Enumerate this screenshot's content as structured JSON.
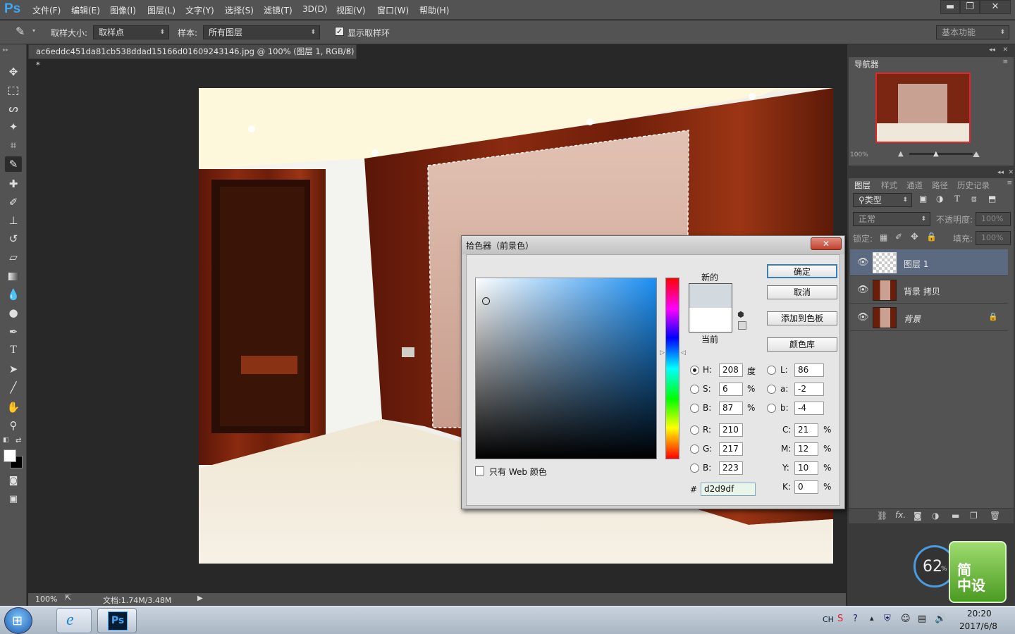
{
  "app": {
    "logo": "Ps"
  },
  "menu": [
    "文件(F)",
    "编辑(E)",
    "图像(I)",
    "图层(L)",
    "文字(Y)",
    "选择(S)",
    "滤镜(T)",
    "3D(D)",
    "视图(V)",
    "窗口(W)",
    "帮助(H)"
  ],
  "window_controls": {
    "minimize": "▬",
    "restore": "❐",
    "close": "✕"
  },
  "options": {
    "sample_size_label": "取样大小:",
    "sample_size_value": "取样点",
    "sample_label": "样本:",
    "sample_value": "所有图层",
    "show_ring_label": "显示取样环",
    "workspace": "基本功能"
  },
  "document": {
    "tab_title": "ac6eddc451da81cb538ddad15166d01609243146.jpg @ 100% (图层 1, RGB/8) *",
    "close": "✕"
  },
  "status": {
    "zoom": "100%",
    "doc_info": "文档:1.74M/3.48M"
  },
  "navigator": {
    "tab": "导航器",
    "zoom": "100%"
  },
  "layers_panel": {
    "tabs": [
      "图层",
      "样式",
      "通道",
      "路径",
      "历史记录"
    ],
    "filter_label": "类型",
    "blend_mode": "正常",
    "opacity_label": "不透明度:",
    "opacity_value": "100%",
    "lock_label": "锁定:",
    "fill_label": "填充:",
    "fill_value": "100%",
    "layers": [
      {
        "name": "图层 1",
        "selected": true
      },
      {
        "name": "背景 拷贝",
        "selected": false
      },
      {
        "name": "背景",
        "selected": false,
        "locked": true
      }
    ]
  },
  "color_picker": {
    "title": "拾色器（前景色）",
    "new_label": "新的",
    "current_label": "当前",
    "new_color": "#d2d9df",
    "current_color": "#ffffff",
    "buttons": {
      "ok": "确定",
      "cancel": "取消",
      "add_swatch": "添加到色板",
      "libraries": "颜色库"
    },
    "web_only_label": "只有 Web 颜色",
    "fields": {
      "H": {
        "label": "H:",
        "value": "208",
        "unit": "度"
      },
      "S": {
        "label": "S:",
        "value": "6",
        "unit": "%"
      },
      "Bv": {
        "label": "B:",
        "value": "87",
        "unit": "%"
      },
      "R": {
        "label": "R:",
        "value": "210"
      },
      "G": {
        "label": "G:",
        "value": "217"
      },
      "Bc": {
        "label": "B:",
        "value": "223"
      },
      "L": {
        "label": "L:",
        "value": "86"
      },
      "a": {
        "label": "a:",
        "value": "-2"
      },
      "b": {
        "label": "b:",
        "value": "-4"
      },
      "C": {
        "label": "C:",
        "value": "21",
        "unit": "%"
      },
      "M": {
        "label": "M:",
        "value": "12",
        "unit": "%"
      },
      "Y": {
        "label": "Y:",
        "value": "10",
        "unit": "%"
      },
      "K": {
        "label": "K:",
        "value": "0",
        "unit": "%"
      }
    },
    "hex_label": "#",
    "hex_value": "d2d9df"
  },
  "widget": {
    "percent": "62",
    "percent_sign": "%",
    "brand": "简\n中设"
  },
  "taskbar": {
    "lang": "CH",
    "time": "20:20",
    "date": "2017/6/8"
  },
  "colors": {
    "ps_blue": "#3ea8f5",
    "panel_bg": "#535353",
    "selected_layer": "#5b6a80"
  }
}
